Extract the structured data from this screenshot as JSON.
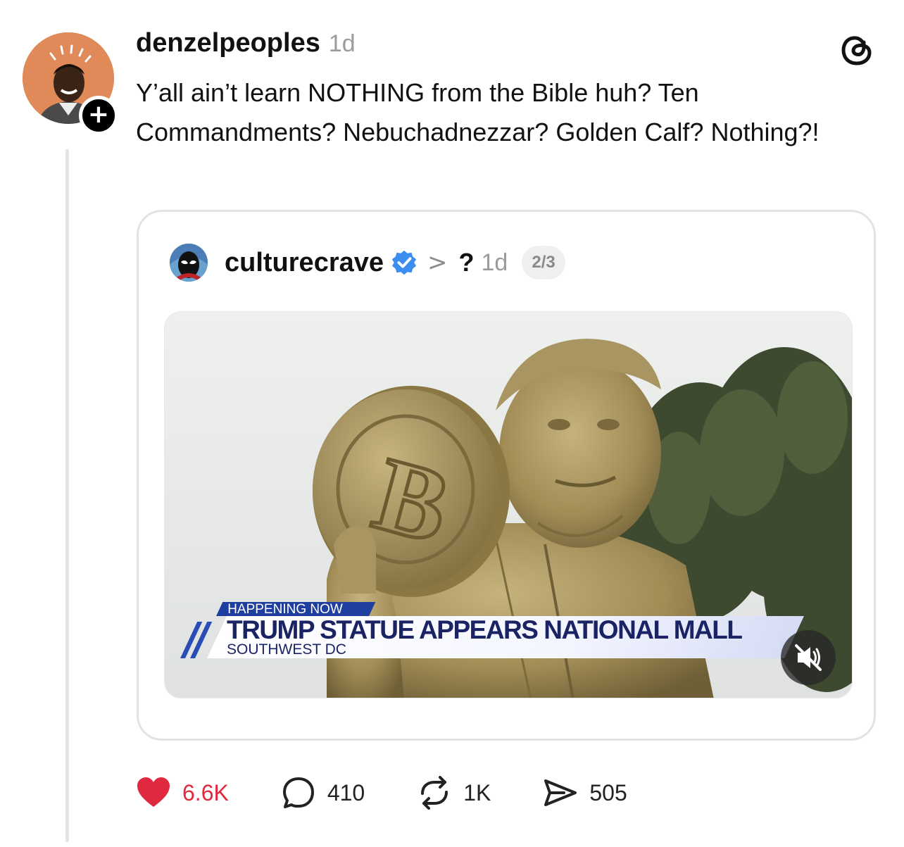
{
  "post": {
    "username": "denzelpeoples",
    "time": "1d",
    "text": "Y’all ain’t learn NOTHING from the Bible huh? Ten Commandments? Nebuchadnezzar? Golden Calf? Nothing?!",
    "follow_glyph": "+"
  },
  "quote": {
    "username": "culturecrave",
    "verified": true,
    "chevron": ">",
    "reply_to": "?",
    "time": "1d",
    "media_counter": "2/3",
    "video": {
      "tag": "HAPPENING NOW",
      "headline": "TRUMP STATUE APPEARS NATIONAL MALL",
      "subline": "SOUTHWEST DC",
      "muted": true
    }
  },
  "actions": {
    "likes": "6.6K",
    "replies": "410",
    "reposts": "1K",
    "shares": "505"
  },
  "icons": {
    "threads": "threads-logo-icon",
    "verified": "verified-badge-icon",
    "like": "heart-filled-icon",
    "reply": "speech-bubble-icon",
    "repost": "repost-arrows-icon",
    "share": "paper-plane-icon",
    "mute": "speaker-muted-icon"
  },
  "colors": {
    "like": "#e0283f",
    "verified": "#3b8ef0",
    "lower_third_tag": "#1f3fa0",
    "lower_third_text": "#1a2464"
  }
}
